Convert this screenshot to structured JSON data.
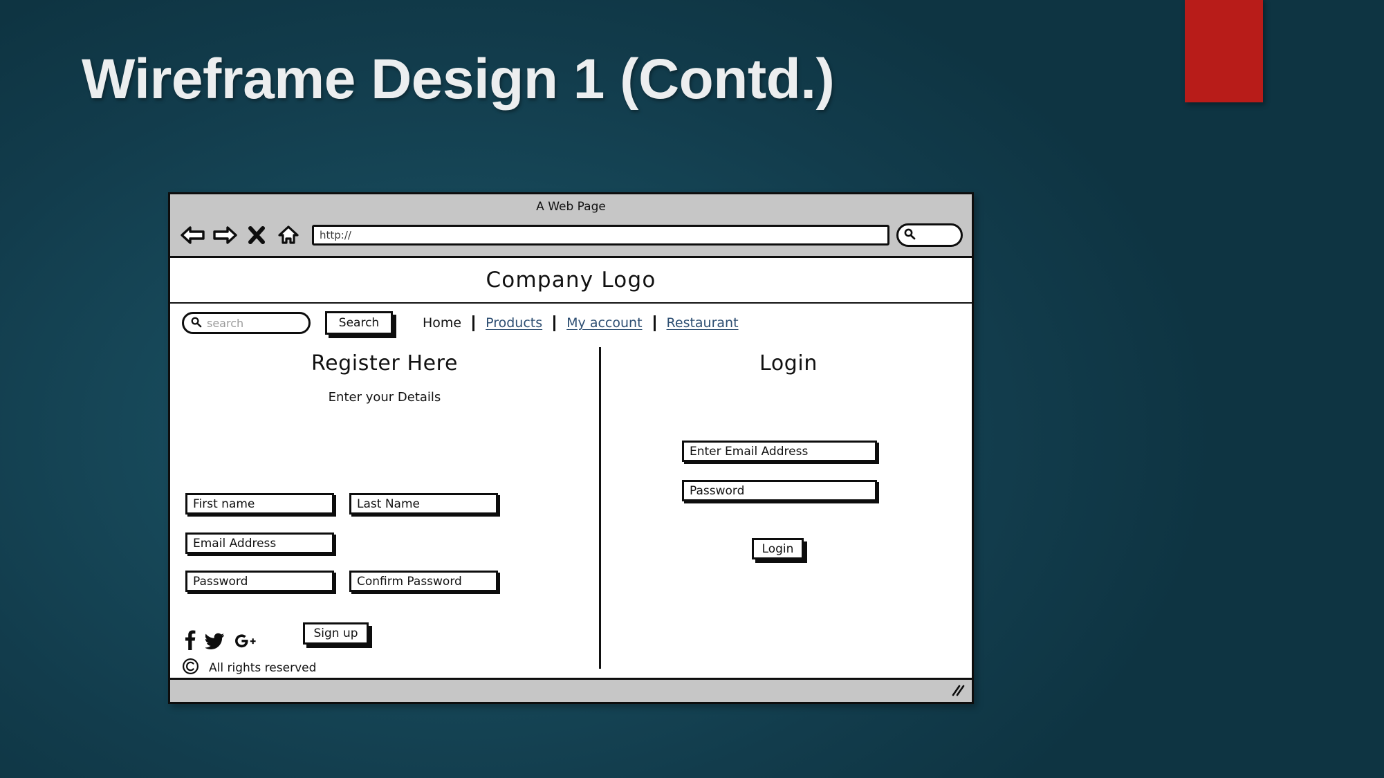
{
  "slide": {
    "title": "Wireframe Design 1 (Contd.)",
    "background_color": "#123c4c",
    "accent_color": "#b81c19",
    "title_color": "#eceeef"
  },
  "browser": {
    "window_title": "A Web Page",
    "url_value": "http://",
    "toolbar_icons": [
      "back-arrow-icon",
      "forward-arrow-icon",
      "close-x-icon",
      "home-icon"
    ],
    "chrome_search_icon": "magnifier-icon"
  },
  "site": {
    "logo_text": "Company Logo",
    "search": {
      "placeholder": "search",
      "icon": "magnifier-icon",
      "button_label": "Search"
    },
    "nav_links": [
      {
        "label": "Home",
        "style": "plain"
      },
      {
        "label": "Products",
        "style": "link"
      },
      {
        "label": "My account",
        "style": "link"
      },
      {
        "label": "Restaurant",
        "style": "link"
      }
    ],
    "link_color": "#2d4e72"
  },
  "register": {
    "heading": "Register Here",
    "subheading": "Enter your Details",
    "fields": {
      "first_name": "First name",
      "last_name": "Last Name",
      "email": "Email Address",
      "password": "Password",
      "confirm_password": "Confirm Password"
    },
    "submit_label": "Sign up"
  },
  "login": {
    "heading": "Login",
    "fields": {
      "email": "Enter Email Address",
      "password": "Password"
    },
    "submit_label": "Login"
  },
  "footer": {
    "social_icons": [
      "facebook-icon",
      "twitter-icon",
      "google-plus-icon"
    ],
    "copyright_icon": "copyright-icon",
    "rights_text": "All rights reserved"
  }
}
